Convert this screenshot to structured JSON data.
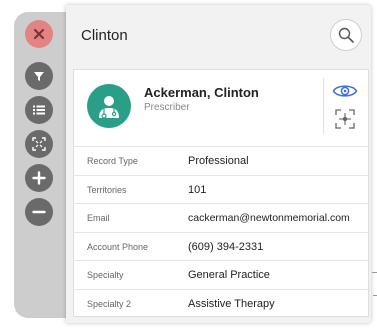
{
  "panel": {
    "title": "Clinton"
  },
  "profile": {
    "name": "Ackerman, Clinton",
    "role": "Prescriber"
  },
  "details": [
    {
      "label": "Record Type",
      "value": "Professional"
    },
    {
      "label": "Territories",
      "value": "101"
    },
    {
      "label": "Email",
      "value": "cackerman@newtonmemorial.com"
    },
    {
      "label": "Account Phone",
      "value": "(609) 394-2331"
    },
    {
      "label": "Specialty",
      "value": "General Practice"
    },
    {
      "label": "Specialty 2",
      "value": "Assistive Therapy"
    }
  ],
  "rail": {
    "buttons": [
      "close-icon",
      "filter-icon",
      "list-icon",
      "fit-screen-icon",
      "zoom-in-icon",
      "zoom-out-icon"
    ]
  },
  "colors": {
    "avatar": "#2a9f87",
    "close_button": "#e48383",
    "rail_button": "#6a6a6a",
    "accent_blue": "#3b6fd6"
  }
}
